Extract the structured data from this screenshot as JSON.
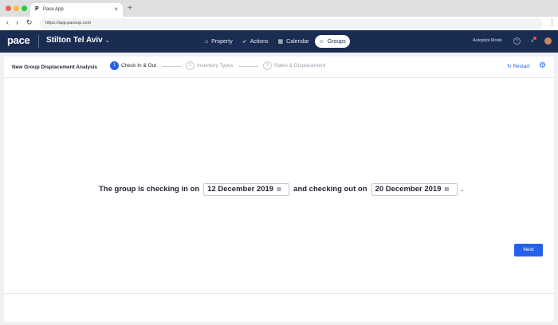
{
  "browser": {
    "tab_favicon": "P",
    "tab_title": "Pace App",
    "tab_close": "×",
    "new_tab": "+",
    "back": "‹",
    "forward": "›",
    "reload": "↻",
    "url": "https://app.paceup.com",
    "menu": "⋮"
  },
  "header": {
    "logo": "pace",
    "property_name": "Stilton Tel Aviv",
    "nav": [
      {
        "label": "Property",
        "icon": "home-icon"
      },
      {
        "label": "Actions",
        "icon": "rocket-icon"
      },
      {
        "label": "Calendar",
        "icon": "calendar-icon"
      },
      {
        "label": "Groups",
        "icon": "groups-icon"
      }
    ],
    "active_nav": "Groups",
    "autopilot_label": "Autopilot Mode"
  },
  "wizard": {
    "title": "New Group Displacement Analysis",
    "steps": [
      {
        "num": "1",
        "label": "Check In & Out"
      },
      {
        "num": "2",
        "label": "Inventory Types"
      },
      {
        "num": "3",
        "label": "Rates & Displacement"
      }
    ],
    "restart_label": "Restart"
  },
  "form": {
    "text_before": "The group is checking in on",
    "checkin_date": "12 December 2019",
    "text_middle": "and checking out on",
    "checkout_date": "20 December 2019",
    "text_after": "."
  },
  "footer": {
    "next_label": "Next"
  },
  "colors": {
    "accent": "#2461ea",
    "header_bg": "#1b2c53"
  }
}
